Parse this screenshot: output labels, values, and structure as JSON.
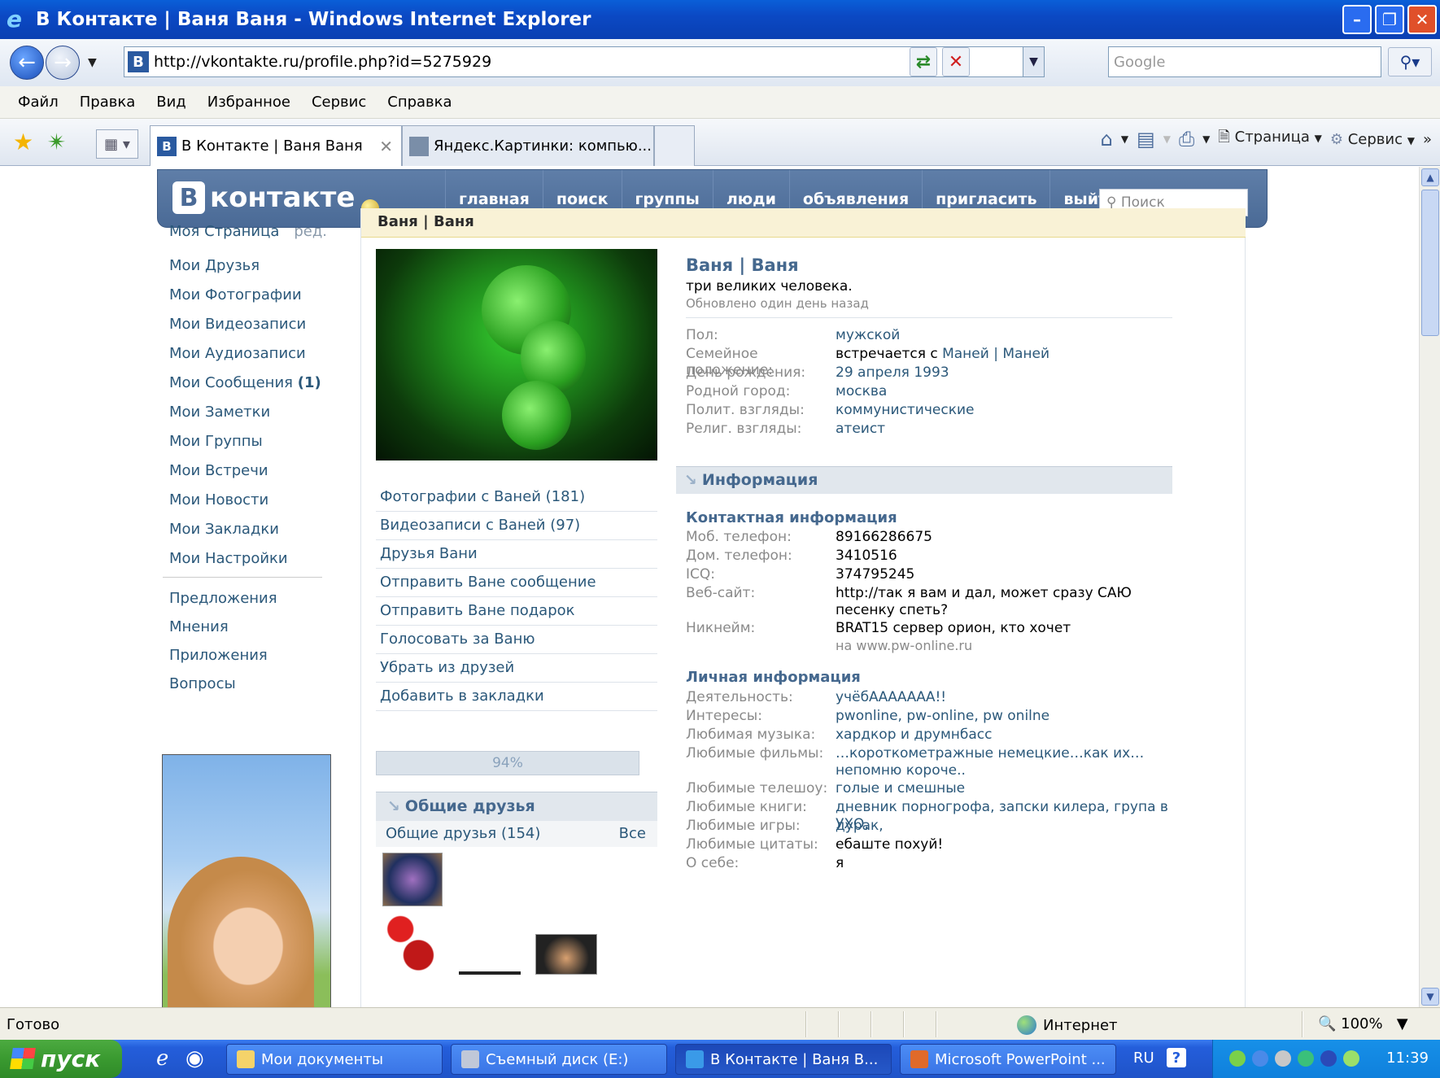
{
  "window": {
    "title": "В Контакте | Ваня Ваня - Windows Internet Explorer"
  },
  "address_bar": {
    "url": "http://vkontakte.ru/profile.php?id=5275929",
    "search_placeholder": "Google"
  },
  "menu": [
    "Файл",
    "Правка",
    "Вид",
    "Избранное",
    "Сервис",
    "Справка"
  ],
  "tabs": [
    {
      "label": "В Контакте | Ваня Ваня",
      "active": true
    },
    {
      "label": "Яндекс.Картинки: компью...",
      "active": false
    }
  ],
  "command_bar": {
    "page_label": "Страница",
    "tools_label": "Сервис"
  },
  "vk": {
    "logo": "контакте",
    "nav": [
      "главная",
      "поиск",
      "группы",
      "люди",
      "объявления",
      "пригласить",
      "выйти"
    ],
    "search_placeholder": "Поиск"
  },
  "left_menu": {
    "my_page": "Моя Страница",
    "edit": "ред.",
    "items": [
      "Мои Друзья",
      "Мои Фотографии",
      "Мои Видеозаписи",
      "Мои Аудиозаписи",
      "Мои Сообщения",
      "Мои Заметки",
      "Мои Группы",
      "Мои Встречи",
      "Мои Новости",
      "Мои Закладки",
      "Мои Настройки"
    ],
    "messages_count": "(1)",
    "extra": [
      "Предложения",
      "Мнения",
      "Приложения",
      "Вопросы"
    ]
  },
  "profile": {
    "breadcrumb": "Ваня | Ваня",
    "name": "Ваня | Ваня",
    "status": "три великих человека.",
    "updated": "Обновлено один день назад",
    "actions": [
      "Фотографии с Ваней (181)",
      "Видеозаписи с Ваней (97)",
      "Друзья Вани",
      "Отправить Ване сообщение",
      "Отправить Ване подарок",
      "Голосовать за Ваню",
      "Убрать из друзей",
      "Добавить в закладки"
    ],
    "rating": "94%",
    "common_friends_header": "Общие друзья",
    "common_friends_count": "Общие друзья (154)",
    "common_friends_all": "Все",
    "basic": [
      {
        "label": "Пол:",
        "value": "мужской"
      },
      {
        "label": "Семейное положение:",
        "value": "встречается с",
        "link": "Маней | Маней"
      },
      {
        "label": "День рождения:",
        "value": "29 апреля 1993"
      },
      {
        "label": "Родной город:",
        "value": "москва"
      },
      {
        "label": "Полит. взгляды:",
        "value": "коммунистические"
      },
      {
        "label": "Религ. взгляды:",
        "value": "атеист"
      }
    ],
    "info_header": "Информация",
    "contact_header": "Контактная информация",
    "contact": [
      {
        "label": "Моб. телефон:",
        "value": "89166286675"
      },
      {
        "label": "Дом. телефон:",
        "value": "3410516"
      },
      {
        "label": "ICQ:",
        "value": "374795245"
      },
      {
        "label": "Веб-сайт:",
        "value": "http://так я вам и дал, может сразу САЮ песенку спеть?"
      },
      {
        "label": "Никнейм:",
        "value": "BRAT15 сервер орион, кто хочет",
        "sub": "на www.pw-online.ru"
      }
    ],
    "personal_header": "Личная информация",
    "personal": [
      {
        "label": "Деятельность:",
        "value": "учёбААААААА!!"
      },
      {
        "label": "Интересы:",
        "value": "pwonline, pw-online, pw onilne"
      },
      {
        "label": "Любимая музыка:",
        "value": "хардкор и друмнбасс"
      },
      {
        "label": "Любимые фильмы:",
        "value": "…короткометражные немецкие…как их… непомню короче.."
      },
      {
        "label": "Любимые телешоу:",
        "value": "голые и смешные"
      },
      {
        "label": "Любимые книги:",
        "value": "дневник порногрофа, запски килера, група в УХО,"
      },
      {
        "label": "Любимые игры:",
        "value": "дурак,"
      },
      {
        "label": "Любимые цитаты:",
        "value": "ебаште похуй!"
      },
      {
        "label": "О себе:",
        "value": "я"
      }
    ]
  },
  "status_bar": {
    "ready": "Готово",
    "zone": "Интернет",
    "zoom": "100%"
  },
  "taskbar": {
    "start": "пуск",
    "buttons": [
      "Мои документы",
      "Съемный диск (E:)",
      "В Контакте | Ваня В...",
      "Microsoft PowerPoint ..."
    ],
    "lang": "RU",
    "clock": "11:39"
  }
}
